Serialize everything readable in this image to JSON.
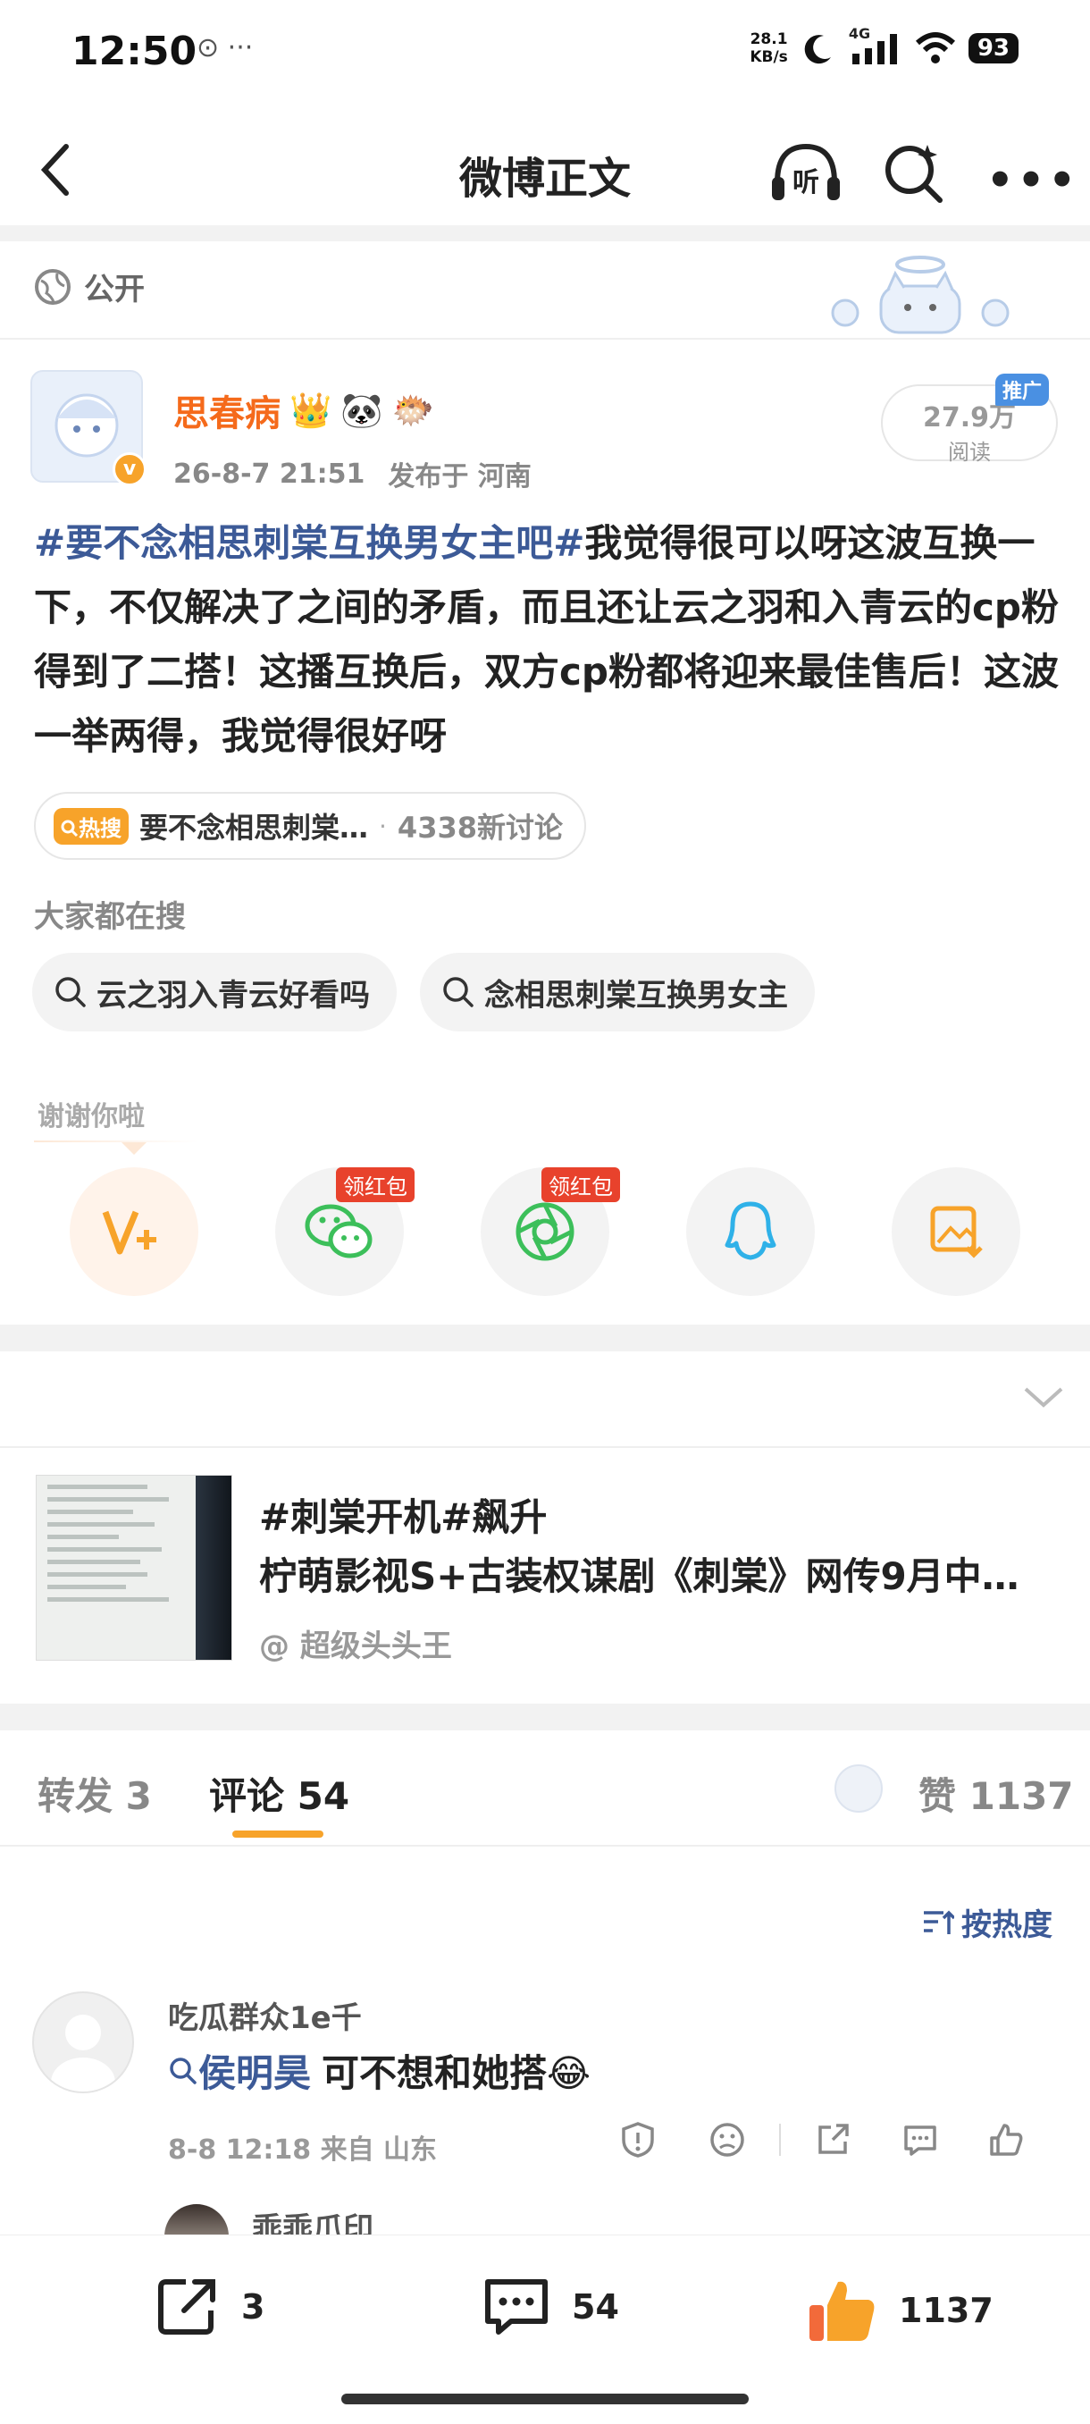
{
  "status_bar": {
    "time": "12:50",
    "extra": "⊙ ···",
    "speed_top": "28.1",
    "speed_bottom": "KB/s",
    "network": "4G",
    "battery": "93"
  },
  "nav": {
    "title": "微博正文"
  },
  "post": {
    "visibility": "公开",
    "author": {
      "name": "思春病",
      "badges": [
        "👑",
        "🐼",
        "🐡"
      ],
      "time": "26-8-7 21:51",
      "location": "发布于 河南"
    },
    "reads": {
      "count": "27.9万",
      "label": "阅读",
      "badge": "推广"
    },
    "hashtag": "#要不念相思刺棠互换男女主吧#",
    "body": "我觉得很可以呀这波互换一下，不仅解决了之间的矛盾，而且还让云之羽和入青云的cp粉得到了二搭！这播互换后，双方cp粉都将迎来最佳售后！这波一举两得，我觉得很好呀",
    "hot_topic": {
      "badge": "热搜",
      "text": "要不念相思刺棠…",
      "separator": "·",
      "count": "4338新讨论"
    },
    "search_section": {
      "label": "大家都在搜",
      "chips": [
        "云之羽入青云好看吗",
        "念相思刺棠互换男女主"
      ]
    },
    "thanks_label": "谢谢你啦",
    "share": {
      "redpack_label_1": "领红包",
      "redpack_label_2": "领红包"
    }
  },
  "linked_card": {
    "title": "#刺棠开机#飙升",
    "subtitle": "柠萌影视S+古装权谋剧《刺棠》网传9月中…",
    "source": "@ 超级头头王"
  },
  "tabs": {
    "repost": "转发 3",
    "comment": "评论 54",
    "likes": "赞 1137"
  },
  "comments": {
    "sort_label": "按热度",
    "items": [
      {
        "name": "吃瓜群众1e千",
        "mention": "侯明昊",
        "text": "可不想和她搭😂",
        "meta": "8-8 12:18  来自 山东"
      },
      {
        "name": "乖乖爪印"
      }
    ]
  },
  "bottom_bar": {
    "repost_count": "3",
    "comment_count": "54",
    "like_count": "1137"
  },
  "colors": {
    "accent_orange": "#f7a32a",
    "author_orange": "#f56a1b",
    "link_blue": "#3c5a97",
    "redpack": "#e8422c"
  }
}
